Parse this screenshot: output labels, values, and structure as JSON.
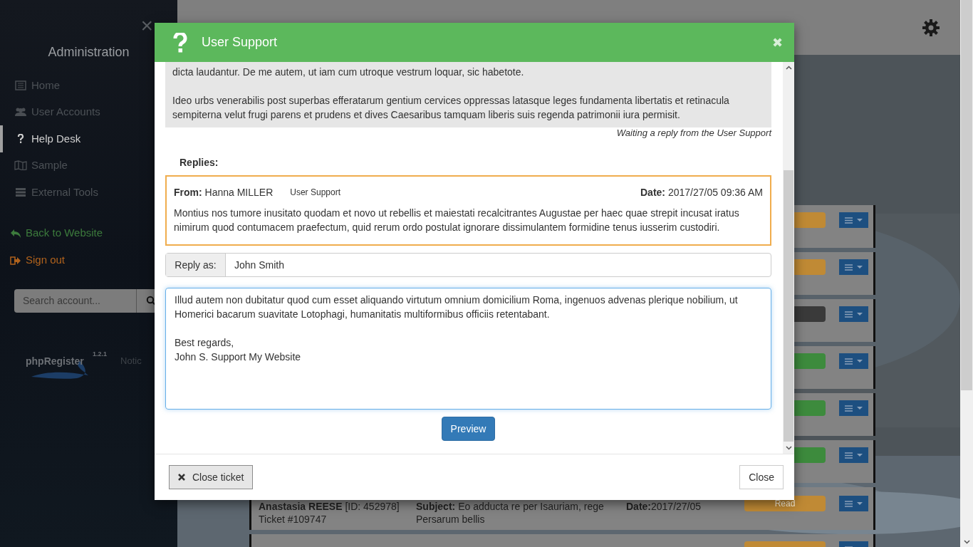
{
  "sidebar": {
    "close": "×",
    "title": "Administration",
    "items": [
      {
        "label": "Home",
        "selected": false
      },
      {
        "label": "User Accounts",
        "selected": false
      },
      {
        "label": "Help Desk",
        "selected": true
      },
      {
        "label": "Sample",
        "selected": false
      },
      {
        "label": "External Tools",
        "selected": false
      }
    ],
    "links": [
      {
        "label": "Back to Website",
        "color": "#3c7a3c"
      },
      {
        "label": "Sign out",
        "color": "#b0621c"
      }
    ],
    "search": {
      "placeholder": "Search account..."
    },
    "logo": {
      "name": "phpRegister",
      "version": "1.2.1"
    },
    "notice": "Notic"
  },
  "tickets": [
    {
      "color": "#c08a35"
    },
    {
      "color": "#c08a35"
    },
    {
      "color": "#3a3a3a"
    },
    {
      "color": "#3d8b3d"
    },
    {
      "color": "#3d8b3d"
    },
    {
      "color": "#3d8b3d"
    },
    {
      "color": "#c08a35",
      "name": "Anastasia REESE",
      "id": "[ID: 452978]",
      "ticket": "Ticket #109747",
      "subject_label": "Subject:",
      "subject": "Eo adducta re per Isauriam, rege Persarum bellis",
      "date_label": "Date:",
      "date": "2017/27/05",
      "badge": "Read"
    },
    {
      "color": "#c08a35"
    }
  ],
  "modal": {
    "title": "User Support",
    "close": "✖",
    "message": [
      "dicta laudantur. De me autem, ut iam cum utroque vestrum loquar, sic habetote.",
      "Ideo urbs venerabilis post superbas efferatarum gentium cervices oppressas latasque leges fundamenta libertatis et retinacula sempiterna velut frugi parens et prudens et dives Caesaribus tamquam liberis suis regenda patrimonii iura permisit."
    ],
    "status": "Waiting a reply from the User Support",
    "replies_label": "Replies:",
    "replies": [
      {
        "from_label": "From:",
        "from": "Hanna MILLER",
        "role": "User Support",
        "date_label": "Date:",
        "date": "2017/27/05 09:36 AM",
        "body": "Montius nos tumore inusitato quodam et novo ut rebellis et maiestati recalcitrantes Augustae per haec quae strepit incusat iratus nimirum quod contumacem praefectum, quid rerum ordo postulat ignorare dissimulantem formidine tenus iusserim custodiri."
      }
    ],
    "reply_as": {
      "label": "Reply as:",
      "value": "John Smith"
    },
    "reply_text": "Illud autem non dubitatur quod cum esset aliquando virtutum omnium domicilium Roma, ingenuos advenas plerique nobilium, ut Homerici bacarum suavitate Lotophagi, humanitatis multiformibus officiis retentabant.\n\nBest regards,\nJohn S. Support My Website",
    "preview": "Preview",
    "close_ticket": "Close ticket",
    "close_button": "Close"
  }
}
